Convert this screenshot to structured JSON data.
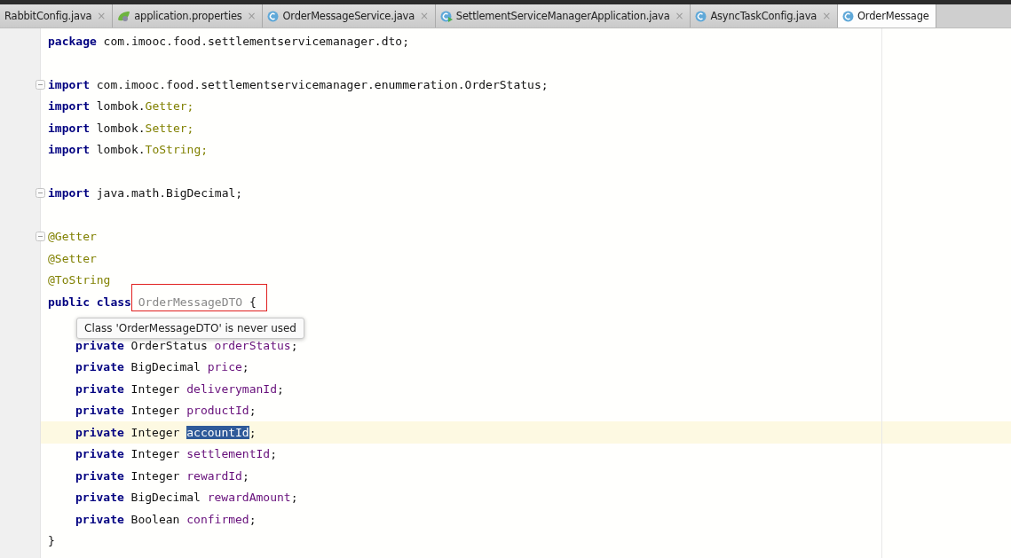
{
  "tabs": [
    {
      "label": "RabbitConfig.java",
      "kind": "plain",
      "close": "×",
      "selected": false
    },
    {
      "label": "application.properties",
      "kind": "properties",
      "close": "×",
      "selected": false
    },
    {
      "label": "OrderMessageService.java",
      "kind": "class",
      "close": "×",
      "selected": false
    },
    {
      "label": "SettlementServiceManagerApplication.java",
      "kind": "app",
      "close": "×",
      "selected": false
    },
    {
      "label": "AsyncTaskConfig.java",
      "kind": "class",
      "close": "×",
      "selected": false
    },
    {
      "label": "OrderMessage",
      "kind": "class",
      "selected": true
    }
  ],
  "editor": {
    "lines": [
      {
        "kind": "code",
        "tokens": [
          {
            "kind": "keyword",
            "text": "package"
          },
          {
            "kind": "text",
            "text": " com.imooc.food.settlementservicemanager.dto;"
          }
        ]
      },
      {
        "kind": "blank"
      },
      {
        "kind": "code",
        "fold": true,
        "tokens": [
          {
            "kind": "keyword",
            "text": "import"
          },
          {
            "kind": "text",
            "text": " com.imooc.food.settlementservicemanager.enummeration.OrderStatus;"
          }
        ]
      },
      {
        "kind": "code",
        "tokens": [
          {
            "kind": "keyword",
            "text": "import"
          },
          {
            "kind": "text",
            "text": " lombok."
          },
          {
            "kind": "annotation",
            "text": "Getter;"
          }
        ]
      },
      {
        "kind": "code",
        "tokens": [
          {
            "kind": "keyword",
            "text": "import"
          },
          {
            "kind": "text",
            "text": " lombok."
          },
          {
            "kind": "annotation",
            "text": "Setter;"
          }
        ]
      },
      {
        "kind": "code",
        "tokens": [
          {
            "kind": "keyword",
            "text": "import"
          },
          {
            "kind": "text",
            "text": " lombok."
          },
          {
            "kind": "annotation",
            "text": "ToString;"
          }
        ]
      },
      {
        "kind": "blank"
      },
      {
        "kind": "code",
        "fold": true,
        "tokens": [
          {
            "kind": "keyword",
            "text": "import"
          },
          {
            "kind": "text",
            "text": " java.math.BigDecimal;"
          }
        ]
      },
      {
        "kind": "blank"
      },
      {
        "kind": "code",
        "fold": true,
        "tokens": [
          {
            "kind": "annotation",
            "text": "@Getter"
          }
        ]
      },
      {
        "kind": "code",
        "tokens": [
          {
            "kind": "annotation",
            "text": "@Setter"
          }
        ]
      },
      {
        "kind": "code",
        "tokens": [
          {
            "kind": "annotation",
            "text": "@ToString"
          }
        ]
      },
      {
        "kind": "code",
        "tokens": [
          {
            "kind": "keyword",
            "text": "public class "
          },
          {
            "kind": "unused",
            "text": "OrderMessageDTO"
          },
          {
            "kind": "text",
            "text": " {"
          }
        ],
        "children": [
          {
            "kind": "blank"
          },
          {
            "kind": "code",
            "tokens": [
              {
                "kind": "keyword",
                "text": "private"
              },
              {
                "kind": "text",
                "text": " OrderStatus "
              },
              {
                "kind": "field",
                "text": "orderStatus"
              },
              {
                "kind": "text",
                "text": ";"
              }
            ]
          },
          {
            "kind": "code",
            "tokens": [
              {
                "kind": "keyword",
                "text": "private"
              },
              {
                "kind": "text",
                "text": " BigDecimal "
              },
              {
                "kind": "field",
                "text": "price"
              },
              {
                "kind": "text",
                "text": ";"
              }
            ]
          },
          {
            "kind": "code",
            "tokens": [
              {
                "kind": "keyword",
                "text": "private"
              },
              {
                "kind": "text",
                "text": " Integer "
              },
              {
                "kind": "field",
                "text": "deliverymanId"
              },
              {
                "kind": "text",
                "text": ";"
              }
            ]
          },
          {
            "kind": "code",
            "tokens": [
              {
                "kind": "keyword",
                "text": "private"
              },
              {
                "kind": "text",
                "text": " Integer "
              },
              {
                "kind": "field",
                "text": "productId"
              },
              {
                "kind": "text",
                "text": ";"
              }
            ]
          },
          {
            "kind": "code",
            "current": true,
            "tokens": [
              {
                "kind": "keyword",
                "text": "private"
              },
              {
                "kind": "text",
                "text": " Integer "
              },
              {
                "kind": "selection",
                "text": "accountId"
              },
              {
                "kind": "text",
                "text": ";"
              }
            ]
          },
          {
            "kind": "code",
            "tokens": [
              {
                "kind": "keyword",
                "text": "private"
              },
              {
                "kind": "text",
                "text": " Integer "
              },
              {
                "kind": "field",
                "text": "settlementId"
              },
              {
                "kind": "text",
                "text": ";"
              }
            ]
          },
          {
            "kind": "code",
            "tokens": [
              {
                "kind": "keyword",
                "text": "private"
              },
              {
                "kind": "text",
                "text": " Integer "
              },
              {
                "kind": "field",
                "text": "rewardId"
              },
              {
                "kind": "text",
                "text": ";"
              }
            ]
          },
          {
            "kind": "code",
            "tokens": [
              {
                "kind": "keyword",
                "text": "private"
              },
              {
                "kind": "text",
                "text": " BigDecimal "
              },
              {
                "kind": "field",
                "text": "rewardAmount"
              },
              {
                "kind": "text",
                "text": ";"
              }
            ]
          },
          {
            "kind": "code",
            "tokens": [
              {
                "kind": "keyword",
                "text": "private"
              },
              {
                "kind": "text",
                "text": " Boolean "
              },
              {
                "kind": "field",
                "text": "confirmed"
              },
              {
                "kind": "text",
                "text": ";"
              }
            ]
          }
        ]
      },
      {
        "kind": "code",
        "tokens": [
          {
            "kind": "text",
            "text": "}"
          }
        ]
      }
    ],
    "tooltip": {
      "text": "Class 'OrderMessageDTO' is never used"
    }
  }
}
